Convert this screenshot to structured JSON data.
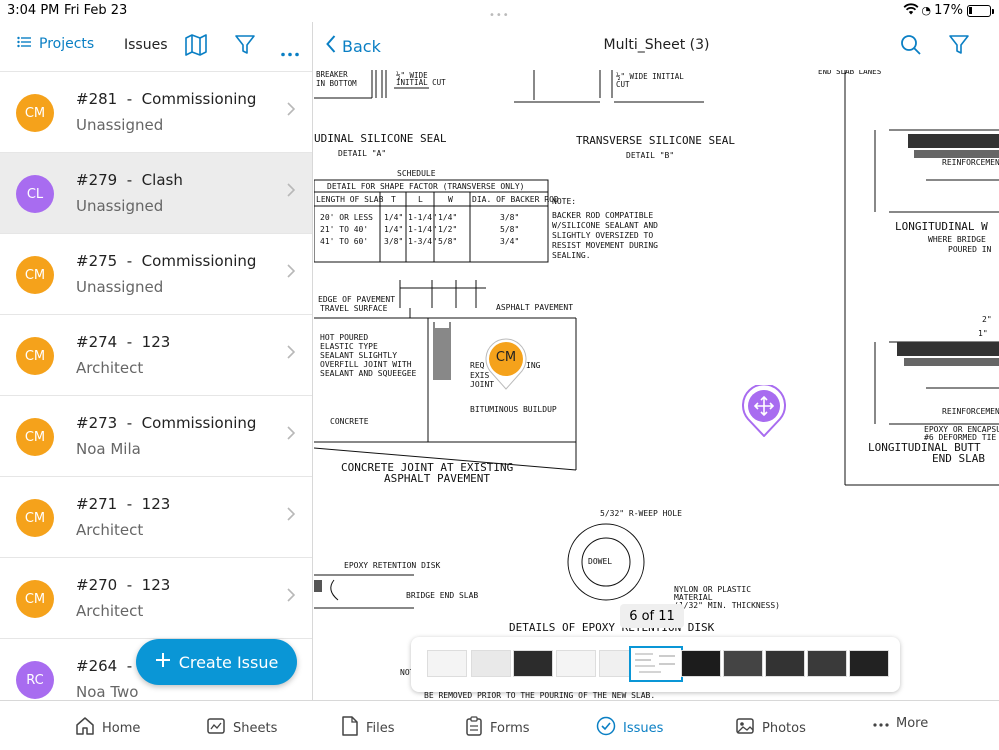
{
  "status_bar": {
    "time": "3:04 PM",
    "date": "Fri Feb 23",
    "battery": "17%"
  },
  "left_header": {
    "projects_label": "Projects",
    "title": "Issues"
  },
  "issues": [
    {
      "initials": "CM",
      "title": "#281  -  Commissioning",
      "subtitle": "Unassigned",
      "color": "#f5a21b"
    },
    {
      "initials": "CL",
      "title": "#279  -  Clash",
      "subtitle": "Unassigned",
      "color": "#a86cf0"
    },
    {
      "initials": "CM",
      "title": "#275  -  Commissioning",
      "subtitle": "Unassigned",
      "color": "#f5a21b"
    },
    {
      "initials": "CM",
      "title": "#274  -  123",
      "subtitle": "Architect",
      "color": "#f5a21b"
    },
    {
      "initials": "CM",
      "title": "#273  -  Commissioning",
      "subtitle": "Noa Mila",
      "color": "#f5a21b"
    },
    {
      "initials": "CM",
      "title": "#271  -  123",
      "subtitle": "Architect",
      "color": "#f5a21b"
    },
    {
      "initials": "CM",
      "title": "#270  -  123",
      "subtitle": "Architect",
      "color": "#f5a21b"
    },
    {
      "initials": "RC",
      "title": "#264  -  A",
      "subtitle": "Noa Two",
      "color": "#a86cf0"
    }
  ],
  "create_issue_label": "Create Issue",
  "viewer": {
    "back_label": "Back",
    "sheet_title": "Multi_Sheet (3)",
    "page_indicator": "6 of 11",
    "pin_initials": "CM"
  },
  "drawing": {
    "breaker": "BREAKER\nIN BOTTOM",
    "wide_cut_a": "½\" WIDE\nINITIAL CUT",
    "wide_cut_b": "½\" WIDE INITIAL\nCUT",
    "seal_a": "UDINAL SILICONE SEAL",
    "detail_a": "DETAIL \"A\"",
    "seal_b": "TRANSVERSE SILICONE SEAL",
    "detail_b": "DETAIL \"B\"",
    "schedule": "SCHEDULE",
    "schedule_title": "DETAIL FOR SHAPE FACTOR (TRANSVERSE ONLY)",
    "schedule_headers": [
      "LENGTH OF SLAB",
      "T",
      "L",
      "W",
      "DIA. OF BACKER ROD"
    ],
    "schedule_rows": [
      [
        "20' OR LESS",
        "1/4\"",
        "1-1/4\"",
        "1/4\"",
        "3/8\""
      ],
      [
        "21' TO 40'",
        "1/4\"",
        "1-1/4\"",
        "1/2\"",
        "5/8\""
      ],
      [
        "41' TO 60'",
        "3/8\"",
        "1-3/4\"",
        "5/8\"",
        "3/4\""
      ]
    ],
    "note_label": "NOTE:",
    "note_text": "BACKER ROD COMPATIBLE\nW/SILICONE SEALANT AND\nSLIGHTLY OVERSIZED TO\nRESIST MOVEMENT DURING\nSEALING.",
    "edge_pavement": "EDGE OF PAVEMENT\nTRAVEL SURFACE",
    "asphalt_pavement": "ASPHALT PAVEMENT",
    "hot_poured": "HOT POURED\nELASTIC TYPE\nSEALANT SLIGHTLY\nOVERFILL JOINT WITH\nSEALANT AND SQUEEGEE",
    "req": "REQ",
    "ing": "ING",
    "exis": "EXIS",
    "joint": "JOINT",
    "bituminous": "BITUMINOUS BUILDUP",
    "concrete": "CONCRETE",
    "joint_title_1": "CONCRETE JOINT AT EXISTING",
    "joint_title_2": "ASPHALT PAVEMENT",
    "weep": "5/32\" R-WEEP HOLE",
    "dowel": "DOWEL",
    "nylon": "NYLON OR PLASTIC\nMATERIAL\n(1/32\" MIN. THICKNESS)",
    "epoxy_disk": "EPOXY RETENTION DISK",
    "bridge_end": "BRIDGE END SLAB",
    "epoxy_details": "DETAILS OF EPOXY RETENTION DISK",
    "not": "NOT",
    "removed": "BE REMOVED PRIOR TO THE POURING OF THE NEW SLAB.",
    "end_slab_top": "END SLAB LANES",
    "reinforcement": "REINFORCEMEN",
    "longitudinal_w": "LONGITUDINAL W",
    "where_bridge": "WHERE BRIDGE",
    "poured": "POURED IN",
    "two_in": "2\"",
    "one_in": "1\"",
    "epoxy_encaps": "EPOXY OR ENCAPSU\n#6 DEFORMED TIE E",
    "longitudinal_butt": "LONGITUDINAL BUTT",
    "end_slab": "END SLAB"
  },
  "tabs": [
    {
      "label": "Home",
      "icon": "home-icon"
    },
    {
      "label": "Sheets",
      "icon": "sheets-icon"
    },
    {
      "label": "Files",
      "icon": "files-icon"
    },
    {
      "label": "Forms",
      "icon": "forms-icon"
    },
    {
      "label": "Issues",
      "icon": "issues-icon",
      "active": true
    },
    {
      "label": "Photos",
      "icon": "photos-icon"
    },
    {
      "label": "More",
      "icon": "more-icon"
    }
  ],
  "colors": {
    "accent": "#0a7fc4",
    "cm_orange": "#f5a21b",
    "purple": "#a86cf0"
  }
}
